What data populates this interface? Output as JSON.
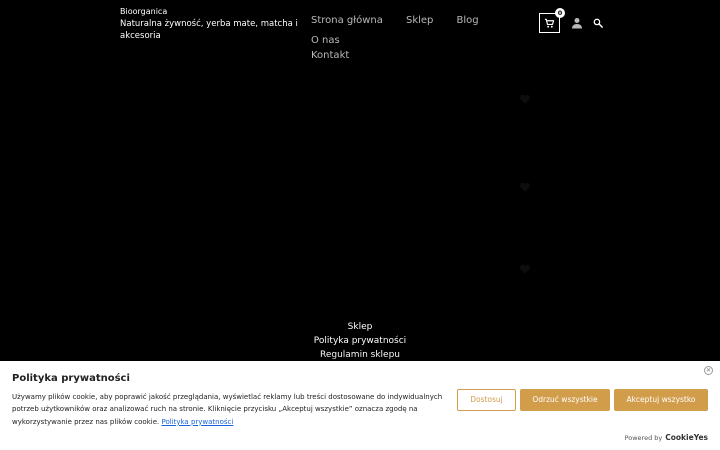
{
  "header": {
    "site_title": "Bioorganica",
    "site_description": "Naturalna żywność, yerba mate, matcha i akcesoria",
    "nav": [
      "Strona główna",
      "Sklep",
      "Blog",
      "O nas",
      "Kontakt"
    ],
    "cart_count": "0",
    "icons": {
      "cart": "cart-icon",
      "user": "user-icon",
      "search": "search-icon"
    }
  },
  "footer": {
    "links": [
      "Sklep",
      "Polityka prywatności",
      "Regulamin sklepu"
    ]
  },
  "cookie_banner": {
    "title": "Polityka prywatności",
    "text": "Używamy plików cookie, aby poprawić jakość przeglądania, wyświetlać reklamy lub treści dostosowane do indywidualnych potrzeb użytkowników oraz analizować ruch na stronie. Kliknięcie przycisku „Akceptuj wszystkie” oznacza zgodę na wykorzystywanie przez nas plików cookie.",
    "policy_link": "Polityka prywatności",
    "buttons": {
      "customize": "Dostosuj",
      "reject": "Odrzuć wszystkie",
      "accept": "Akceptuj wszystko"
    },
    "powered_by": "Powered by",
    "powered_brand": "CookieYes",
    "accent_color": "#d19d4b"
  },
  "colors": {
    "background": "#000000",
    "nav_text": "#b9b9b9",
    "link": "#1863dc"
  }
}
